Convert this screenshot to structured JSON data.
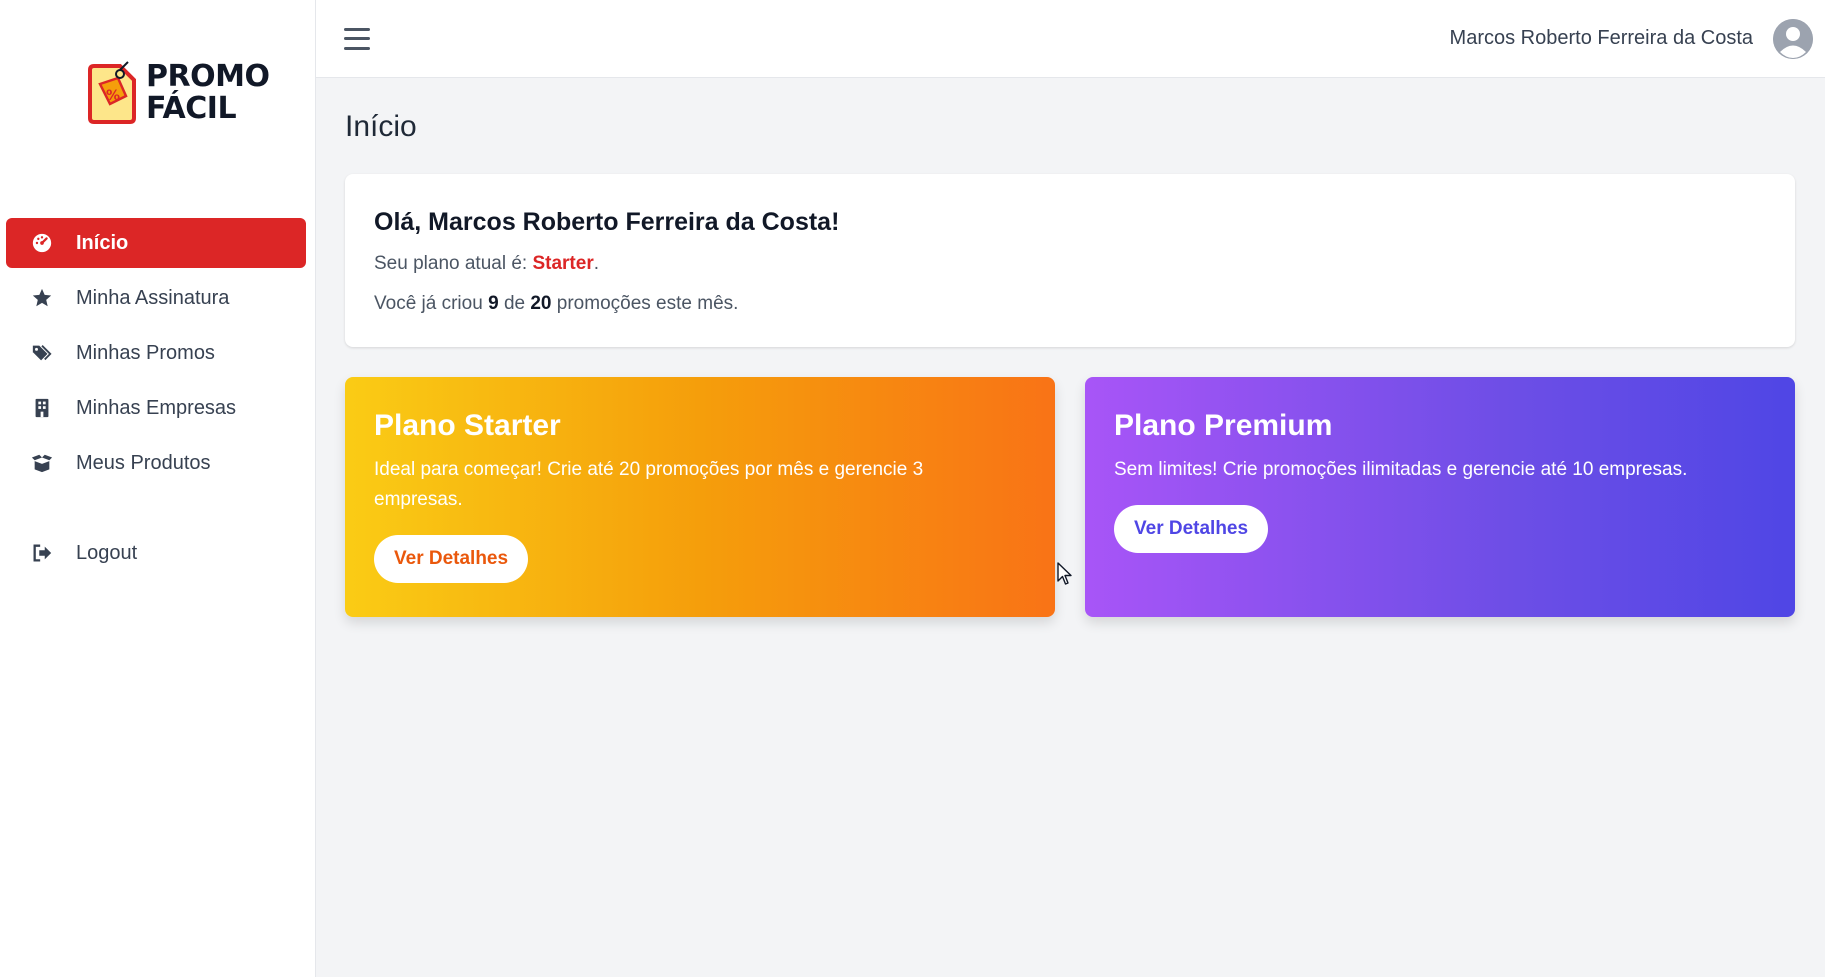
{
  "brand": {
    "line1": "PROMO",
    "line2": "FÁCIL",
    "accent_color": "#dc2626"
  },
  "sidebar": {
    "items": [
      {
        "label": "Início",
        "icon": "dashboard-icon",
        "active": true
      },
      {
        "label": "Minha Assinatura",
        "icon": "star-icon",
        "active": false
      },
      {
        "label": "Minhas Promos",
        "icon": "tags-icon",
        "active": false
      },
      {
        "label": "Minhas Empresas",
        "icon": "building-icon",
        "active": false
      },
      {
        "label": "Meus Produtos",
        "icon": "box-open-icon",
        "active": false
      }
    ],
    "logout": {
      "label": "Logout",
      "icon": "sign-out-icon"
    }
  },
  "topbar": {
    "menu_icon": "hamburger-icon",
    "user_name": "Marcos Roberto Ferreira da Costa",
    "avatar_icon": "user-circle-icon"
  },
  "main": {
    "title": "Início",
    "welcome": {
      "greeting": "Olá, Marcos Roberto Ferreira da Costa!",
      "plan_prefix": "Seu plano atual é:",
      "plan_name": "Starter",
      "plan_suffix": ".",
      "usage_prefix": "Você já criou",
      "used": "9",
      "usage_middle": "de",
      "limit": "20",
      "usage_suffix": "promoções este mês."
    },
    "plans": [
      {
        "title": "Plano Starter",
        "description": "Ideal para começar! Crie até 20 promoções por mês e gerencie 3 empresas.",
        "button": "Ver Detalhes",
        "gradient": [
          "#facc15",
          "#f97316"
        ]
      },
      {
        "title": "Plano Premium",
        "description": "Sem limites! Crie promoções ilimitadas e gerencie até 10 empresas.",
        "button": "Ver Detalhes",
        "gradient": [
          "#a855f7",
          "#4f46e5"
        ]
      }
    ]
  }
}
